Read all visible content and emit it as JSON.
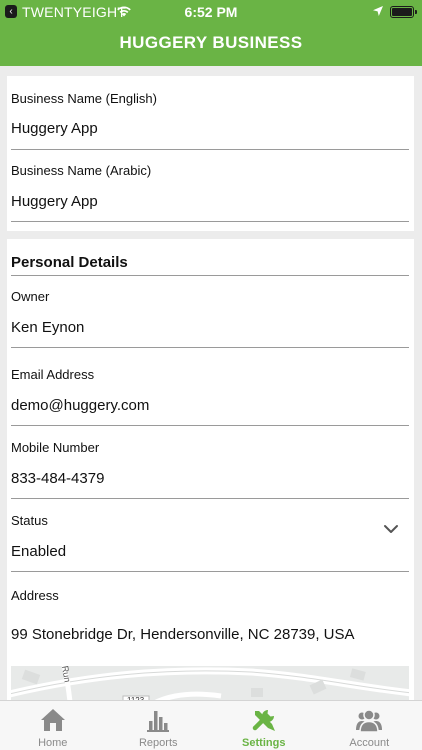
{
  "status_bar": {
    "carrier": "TWENTYEIGHT",
    "time": "6:52 PM"
  },
  "nav": {
    "title": "HUGGERY BUSINESS"
  },
  "business": {
    "name_en_label": "Business Name (English)",
    "name_en_value": "Huggery App",
    "name_ar_label": "Business Name (Arabic)",
    "name_ar_value": "Huggery App"
  },
  "personal": {
    "section_title": "Personal Details",
    "owner_label": "Owner",
    "owner_value": "Ken Eynon",
    "email_label": "Email Address",
    "email_value": "demo@huggery.com",
    "mobile_label": "Mobile Number",
    "mobile_value": "833-484-4379",
    "status_label": "Status",
    "status_value": "Enabled",
    "address_label": "Address",
    "address_value": "99 Stonebridge Dr, Hendersonville, NC 28739, USA"
  },
  "map": {
    "street_label": "Run",
    "route_label": "1123"
  },
  "tabs": [
    {
      "label": "Home",
      "icon": "home-icon"
    },
    {
      "label": "Reports",
      "icon": "bar-chart-icon"
    },
    {
      "label": "Settings",
      "icon": "tools-icon"
    },
    {
      "label": "Account",
      "icon": "users-icon"
    }
  ],
  "colors": {
    "brand_green": "#6ab445",
    "inactive_gray": "#8a8a8a"
  }
}
